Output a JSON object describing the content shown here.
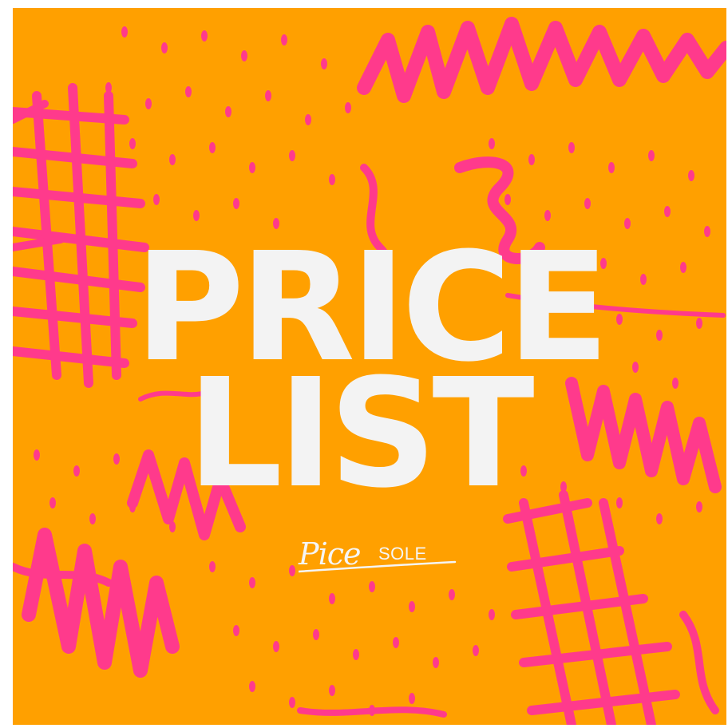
{
  "poster": {
    "headline_line1": "PRICE",
    "headline_line2": "LIST",
    "logo_script": "Pice",
    "logo_brand": "SOLE"
  },
  "colors": {
    "background": "#FFA000",
    "pattern": "#FF3A8C",
    "text": "#F3F3F3"
  }
}
